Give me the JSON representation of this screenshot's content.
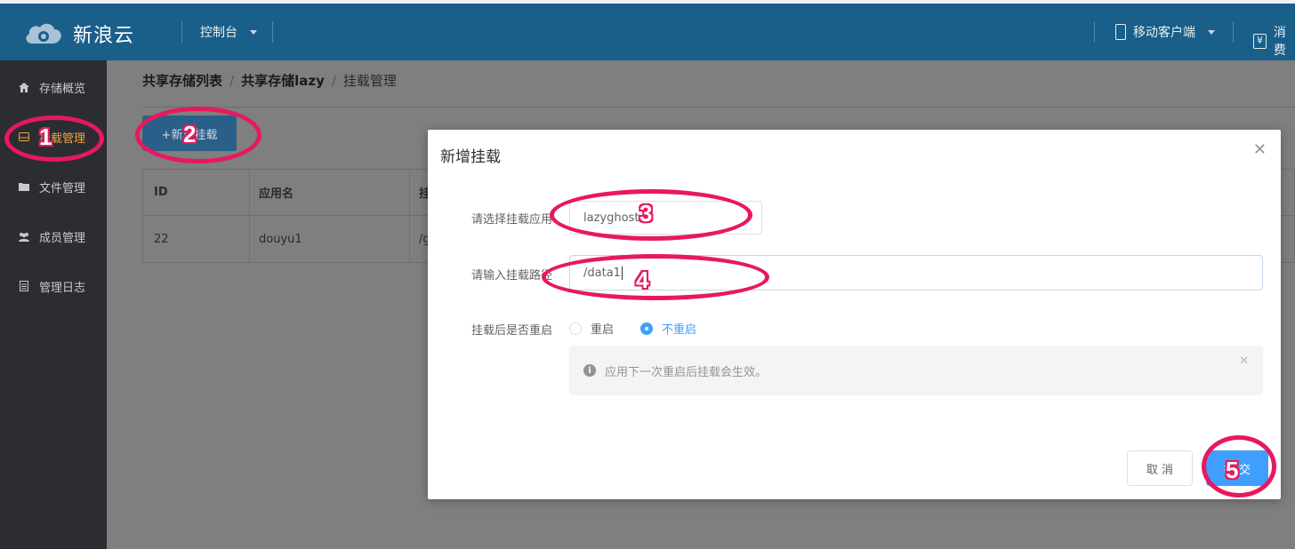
{
  "header": {
    "brand": "新浪云",
    "console_menu": "控制台",
    "mobile_client": "移动客户端",
    "right_truncated": "消费"
  },
  "sidebar": {
    "items": [
      {
        "label": "存储概览",
        "icon": "home-icon"
      },
      {
        "label": "挂载管理",
        "icon": "drive-icon",
        "active": true
      },
      {
        "label": "文件管理",
        "icon": "folder-icon"
      },
      {
        "label": "成员管理",
        "icon": "users-icon"
      },
      {
        "label": "管理日志",
        "icon": "document-icon"
      }
    ]
  },
  "breadcrumb": {
    "level1": "共享存储列表",
    "level2": "共享存储lazy",
    "current": "挂载管理",
    "separator": "/"
  },
  "toolbar": {
    "add_label": "+新增挂载"
  },
  "table": {
    "columns": [
      "ID",
      "应用名",
      "挂"
    ],
    "rows": [
      {
        "id": "22",
        "app": "douyu1",
        "path": "/g"
      }
    ]
  },
  "modal": {
    "title": "新增挂载",
    "select_label": "请选择挂载应用",
    "select_value": "lazyghost",
    "path_label": "请输入挂载路径",
    "path_value": "/data1",
    "restart_label": "挂载后是否重启",
    "restart_options": [
      "重启",
      "不重启"
    ],
    "restart_selected": "不重启",
    "alert_text": "应用下一次重启后挂载会生效。",
    "cancel_label": "取 消",
    "submit_label": "提 交"
  },
  "annotations": [
    "1",
    "2",
    "3",
    "4",
    "5"
  ],
  "colors": {
    "header_bg": "#1a5f8a",
    "sidebar_bg": "#2b2d32",
    "active_item": "#f0a43a",
    "primary": "#409eff",
    "annotation": "#e8185f"
  }
}
